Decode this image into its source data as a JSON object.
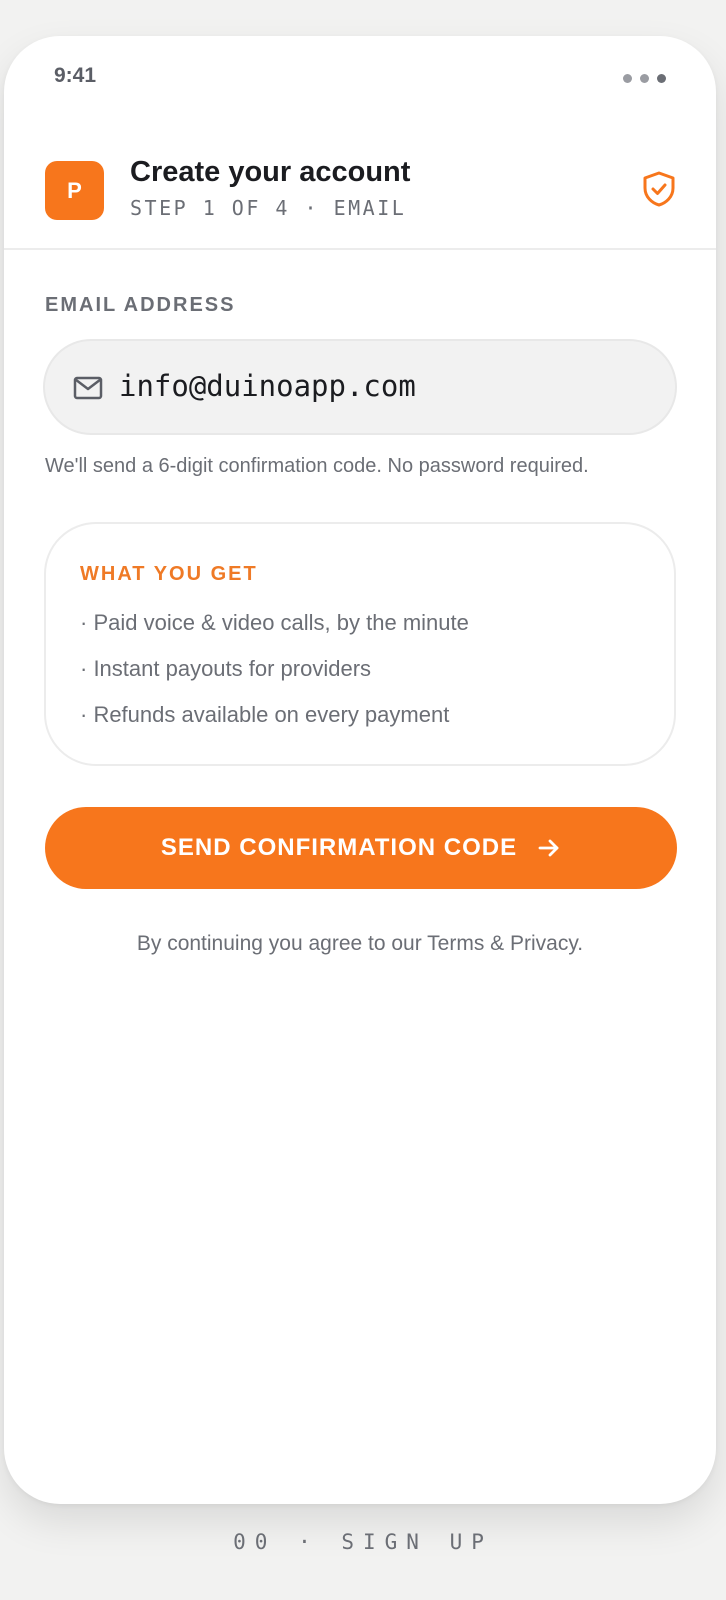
{
  "status": {
    "time": "9:41"
  },
  "header": {
    "logo_letter": "P",
    "title": "Create your account",
    "subtitle": "STEP 1 OF 4 · EMAIL",
    "shield_icon": "shield-check-icon"
  },
  "form": {
    "email_label": "EMAIL ADDRESS",
    "email_value": "info@duinoapp.com",
    "email_icon": "mail-icon",
    "hint": "We'll send a 6-digit confirmation code. No password required."
  },
  "benefits": {
    "title": "WHAT YOU GET",
    "items": [
      "· Paid voice & video calls, by the minute",
      "· Instant payouts for providers",
      "· Refunds available on every payment"
    ]
  },
  "cta": {
    "label": "SEND CONFIRMATION CODE",
    "icon": "arrow-right-icon"
  },
  "terms": "By continuing you agree to our Terms & Privacy.",
  "footer": "00 · SIGN UP",
  "colors": {
    "accent": "#f7761c",
    "accent_text": "#ef7a26",
    "muted": "#6b6e75",
    "ink": "#1b1c20"
  }
}
